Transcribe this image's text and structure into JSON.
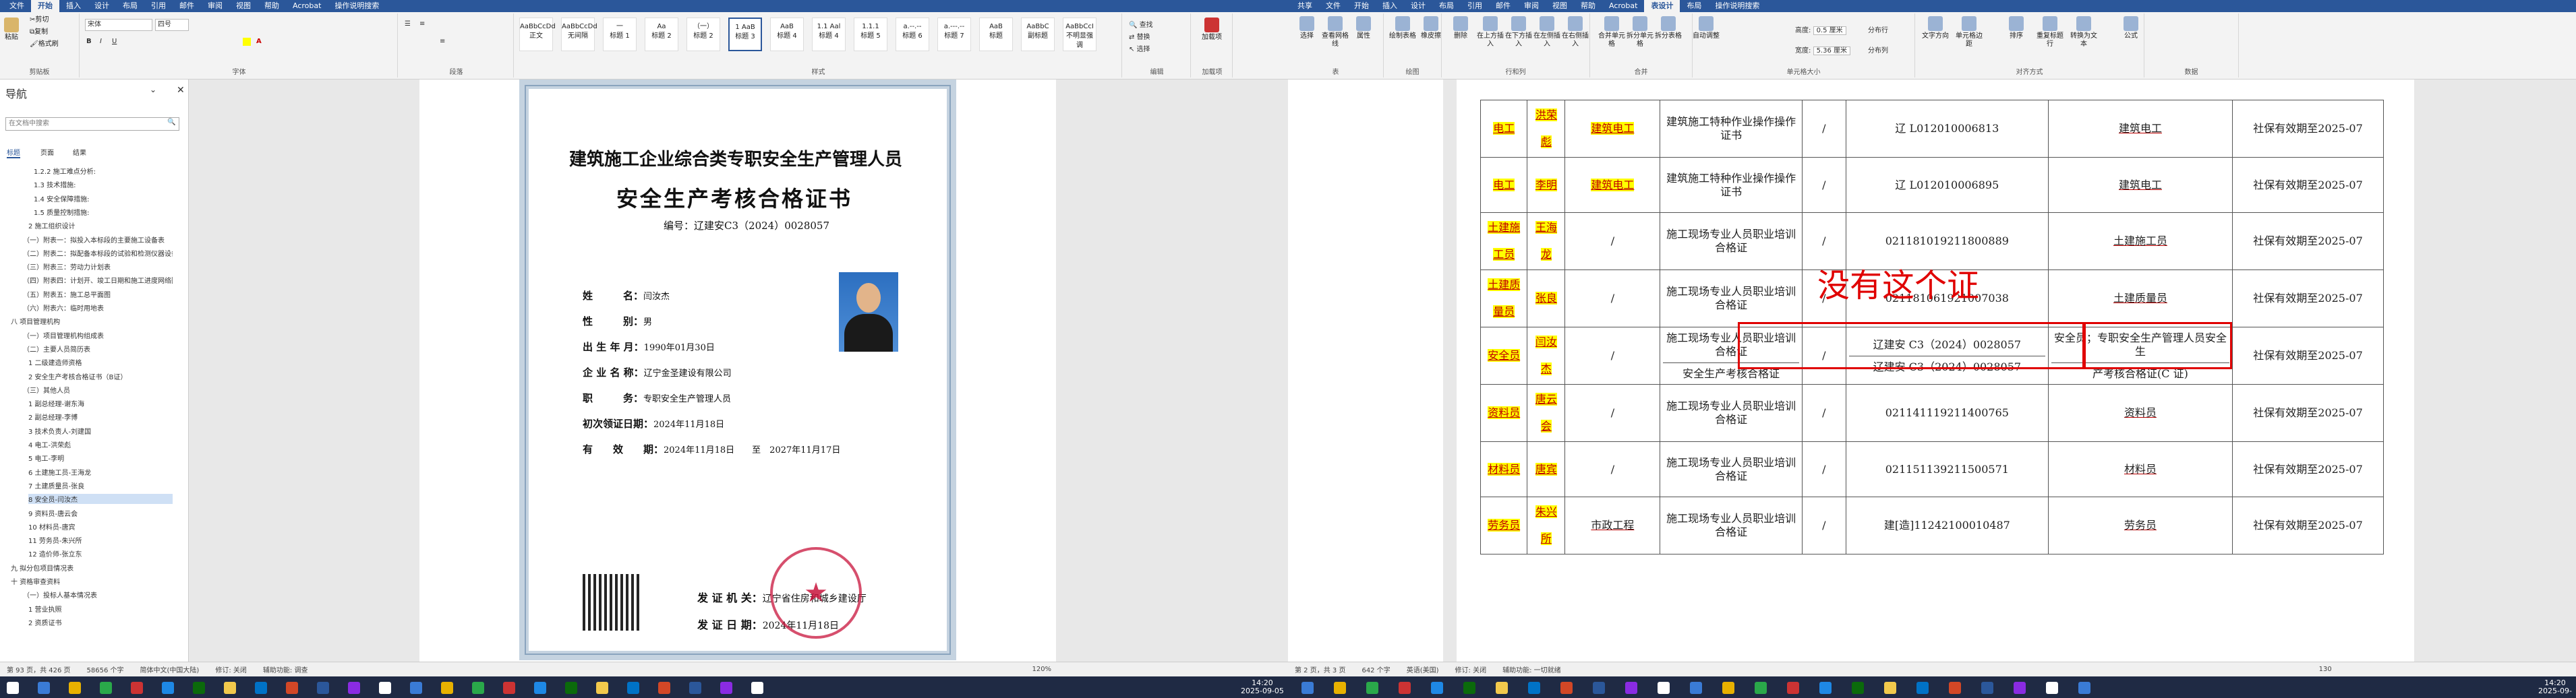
{
  "left_tabs": [
    "文件",
    "开始",
    "插入",
    "设计",
    "布局",
    "引用",
    "邮件",
    "审阅",
    "视图",
    "帮助",
    "Acrobat",
    "操作说明搜索"
  ],
  "right_tabs": [
    "共享",
    "文件",
    "开始",
    "插入",
    "设计",
    "布局",
    "引用",
    "邮件",
    "审阅",
    "视图",
    "帮助",
    "Acrobat",
    "表设计",
    "布局",
    "操作说明搜索"
  ],
  "left_ribbon": {
    "font_name": "宋体",
    "font_size": "四号",
    "paste": "粘贴",
    "cut": "剪切",
    "copy": "复制",
    "format_painter": "格式刷",
    "groups": [
      "剪贴板",
      "字体",
      "段落",
      "样式",
      "编辑",
      "加载项"
    ],
    "styles": [
      {
        "sample": "AaBbCcDd",
        "name": "正文"
      },
      {
        "sample": "AaBbCcDd",
        "name": "无间隔"
      },
      {
        "sample": "一",
        "name": "标题 1"
      },
      {
        "sample": "Aa",
        "name": "标题 2"
      },
      {
        "sample": "（一）",
        "name": "标题 2"
      },
      {
        "sample": "1  AaB",
        "name": "标题 3"
      },
      {
        "sample": "AaB",
        "name": "标题 4"
      },
      {
        "sample": "1.1 Aal",
        "name": "标题 4"
      },
      {
        "sample": "1.1.1",
        "name": "标题 5"
      },
      {
        "sample": "a.--.--",
        "name": "标题 6"
      },
      {
        "sample": "a.---.--",
        "name": "标题 7"
      },
      {
        "sample": "AaB",
        "name": "标题"
      },
      {
        "sample": "AaBbC",
        "name": "副标题"
      },
      {
        "sample": "AaBbCcI",
        "name": "不明显强调"
      }
    ],
    "find": "查找",
    "replace": "替换",
    "select": "选择",
    "addin": "加载项"
  },
  "right_ribbon": {
    "groups": [
      "表",
      "绘图",
      "行和列",
      "合并",
      "单元格大小",
      "对齐方式",
      "数据"
    ],
    "buttons": [
      "选择",
      "查看网格线",
      "属性",
      "绘制表格",
      "橡皮擦",
      "删除",
      "在上方插入",
      "在下方插入",
      "在左侧插入",
      "在右侧插入",
      "合并单元格",
      "拆分单元格",
      "拆分表格",
      "自动调整",
      "文字方向",
      "单元格边距",
      "排序",
      "重复标题行",
      "转换为文本",
      "公式"
    ],
    "height_label": "高度:",
    "height_val": "0.5 厘米",
    "width_label": "宽度:",
    "width_val": "5.36 厘米",
    "dist_rows": "分布行",
    "dist_cols": "分布列"
  },
  "nav": {
    "title": "导航",
    "search_placeholder": "在文档中搜索",
    "tabs": [
      "标题",
      "页面",
      "结果"
    ],
    "items": [
      "1.2.2 施工难点分析:",
      "1.3 技术措施:",
      "1.4 安全保障措施:",
      "1.5 质量控制措施:",
      "2 施工组织设计",
      "（一）附表一：拟投入本标段的主要施工设备表",
      "（二）附表二：拟配备本标段的试验和检测仪器设备表",
      "（三）附表三：劳动力计划表",
      "（四）附表四：计划开、竣工日期和施工进度网络图",
      "（五）附表五：施工总平面图",
      "（六）附表六：临时用地表",
      "八 项目管理机构",
      "（一）项目管理机构组成表",
      "（二）主要人员简历表",
      "1 二级建造师资格",
      "2 安全生产考核合格证书（B证）",
      "（三）其他人员",
      "1 副总经理-谢东海",
      "2 副总经理-李博",
      "3 技术负责人-刘建国",
      "4 电工-洪荣彪",
      "5 电工-李明",
      "6 土建施工员-王海龙",
      "7 土建质量员-张良",
      "8 安全员-闫汝杰",
      "9 资料员-唐云会",
      "10 材料员-唐宾",
      "11 劳务员-朱兴所",
      "12 造价师-张立东",
      "九 拟分包项目情况表",
      "十 资格审查资料",
      "（一）投标人基本情况表",
      "1 营业执照",
      "2 资质证书"
    ]
  },
  "cert": {
    "title1": "建筑施工企业综合类专职安全生产管理人员",
    "title2": "安全生产考核合格证书",
    "number_label": "编号：",
    "number": "辽建安C3（2024）0028057",
    "fields": [
      {
        "label": "姓　　　名：",
        "value": "闫汝杰"
      },
      {
        "label": "性　　　别：",
        "value": "男"
      },
      {
        "label": "出 生 年 月：",
        "value": "1990年01月30日"
      },
      {
        "label": "企 业 名 称：",
        "value": "辽宁金圣建设有限公司"
      },
      {
        "label": "职　　　务：",
        "value": "专职安全生产管理人员"
      },
      {
        "label": "初次领证日期：",
        "value": "2024年11月18日"
      },
      {
        "label": "有　　效　　期：",
        "value": "2024年11月18日　　至　2027年11月17日"
      }
    ],
    "issuer_label": "发 证 机 关：",
    "issuer": "辽宁省住房和城乡建设厅",
    "date_label": "发 证 日 期：",
    "date": "2024年11月18日",
    "seal_text": "辽宁省住房和城乡建设厅"
  },
  "table": {
    "rows": [
      {
        "role": "电工",
        "name": "洪荣彪",
        "major": "建筑电工",
        "cert": "建筑施工特种作业操作操作证书",
        "grade": "/",
        "no": "辽 L012010006813",
        "scope": "建筑电工",
        "valid": "社保有效期至2025-07"
      },
      {
        "role": "电工",
        "name": "李明",
        "major": "建筑电工",
        "cert": "建筑施工特种作业操作操作证书",
        "grade": "/",
        "no": "辽 L012010006895",
        "scope": "建筑电工",
        "valid": "社保有效期至2025-07"
      },
      {
        "role": "土建施工员",
        "name": "王海龙",
        "major": "/",
        "cert": "施工现场专业人员职业培训合格证",
        "grade": "/",
        "no": "021181019211800889",
        "scope": "土建施工员",
        "valid": "社保有效期至2025-07"
      },
      {
        "role": "土建质量员",
        "name": "张良",
        "major": "/",
        "cert": "施工现场专业人员职业培训合格证",
        "grade": "/",
        "no": "021181061921007038",
        "scope": "土建质量员",
        "valid": "社保有效期至2025-07"
      },
      {
        "role": "安全员",
        "name": "闫汝杰",
        "major": "/",
        "cert": "施工现场专业人员职业培训合格证",
        "grade": "/",
        "no": "辽建安 C3（2024）0028057",
        "scope": "安全员；专职安全生产管理人员安全生",
        "valid": "社保有效期至2025-07",
        "cert2": "安全生产考核合格证",
        "no2": "辽建安 C3（2024）0028057",
        "scope2": "产考核合格证(C 证)"
      },
      {
        "role": "资料员",
        "name": "唐云会",
        "major": "/",
        "cert": "施工现场专业人员职业培训合格证",
        "grade": "/",
        "no": "021141119211400765",
        "scope": "资料员",
        "valid": "社保有效期至2025-07"
      },
      {
        "role": "材料员",
        "name": "唐宾",
        "major": "/",
        "cert": "施工现场专业人员职业培训合格证",
        "grade": "/",
        "no": "021151139211500571",
        "scope": "材料员",
        "valid": "社保有效期至2025-07"
      },
      {
        "role": "劳务员",
        "name": "朱兴所",
        "major": "市政工程",
        "cert": "施工现场专业人员职业培训合格证",
        "grade": "/",
        "no": "建[造]11242100010487",
        "scope": "劳务员",
        "valid": "社保有效期至2025-07"
      }
    ],
    "overlay_note": "没有这个证"
  },
  "status_left": {
    "page": "第 93 页，共 426 页",
    "words": "58656 个字",
    "lang": "简体中文(中国大陆)",
    "track": "修订: 关闭",
    "access": "辅助功能: 调查",
    "zoom": "120%"
  },
  "status_right": {
    "page": "第 2 页，共 3 页",
    "words": "642 个字",
    "lang": "英语(美国)",
    "track": "修订: 关闭",
    "access": "辅助功能: 一切就绪",
    "zoom": "130"
  },
  "taskbar": {
    "time1": "14:20",
    "date1": "2025-09-05",
    "time2": "14:20",
    "date2": "2025-09-"
  },
  "colors": {
    "ribbon_blue": "#2b579a",
    "highlight": "#ffff00",
    "alert_red": "#e00000"
  }
}
